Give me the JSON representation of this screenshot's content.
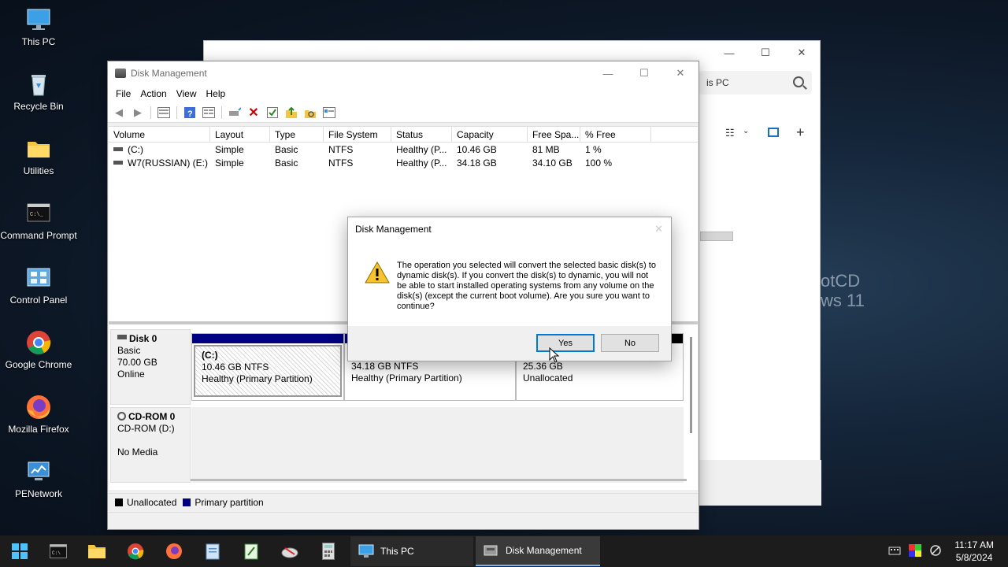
{
  "desktop": {
    "icons": [
      {
        "label": "This PC",
        "icon": "monitor-icon"
      },
      {
        "label": "Recycle Bin",
        "icon": "recycle-bin-icon"
      },
      {
        "label": "Utilities",
        "icon": "folder-icon"
      },
      {
        "label": "Command Prompt",
        "icon": "terminal-icon"
      },
      {
        "label": "Control Panel",
        "icon": "control-panel-icon"
      },
      {
        "label": "Google Chrome",
        "icon": "chrome-icon"
      },
      {
        "label": "Mozilla Firefox",
        "icon": "firefox-icon"
      },
      {
        "label": "PENetwork",
        "icon": "network-icon"
      }
    ],
    "watermark_line1": "otCD",
    "watermark_line2": "ws 11"
  },
  "explorer": {
    "search_placeholder": "is PC"
  },
  "disk_mgmt": {
    "title": "Disk Management",
    "menu": [
      "File",
      "Action",
      "View",
      "Help"
    ],
    "columns": [
      "Volume",
      "Layout",
      "Type",
      "File System",
      "Status",
      "Capacity",
      "Free Spa...",
      "% Free"
    ],
    "volumes": [
      {
        "volume": "(C:)",
        "layout": "Simple",
        "type": "Basic",
        "fs": "NTFS",
        "status": "Healthy (P...",
        "capacity": "10.46 GB",
        "free": "81 MB",
        "pct": "1 %"
      },
      {
        "volume": "W7(RUSSIAN) (E:)",
        "layout": "Simple",
        "type": "Basic",
        "fs": "NTFS",
        "status": "Healthy (P...",
        "capacity": "34.18 GB",
        "free": "34.10 GB",
        "pct": "100 %"
      }
    ],
    "disk0": {
      "name": "Disk 0",
      "type": "Basic",
      "size": "70.00 GB",
      "state": "Online",
      "partitions": [
        {
          "name": "(C:)",
          "line1": "10.46 GB NTFS",
          "line2": "Healthy (Primary Partition)"
        },
        {
          "name": "",
          "line1": "34.18 GB NTFS",
          "line2": "Healthy (Primary Partition)"
        },
        {
          "name": "",
          "line1": "25.36 GB",
          "line2": "Unallocated"
        }
      ]
    },
    "cdrom0": {
      "name": "CD-ROM 0",
      "drive": "CD-ROM (D:)",
      "media": "No Media"
    },
    "legend": {
      "unallocated": "Unallocated",
      "primary": "Primary partition",
      "unallocated_color": "#000000",
      "primary_color": "#000080"
    }
  },
  "dialog": {
    "title": "Disk Management",
    "message": "The operation you selected will convert the selected basic disk(s) to dynamic disk(s). If you convert the disk(s) to dynamic, you will not be able to start installed operating systems from any volume on the disk(s) (except the current boot volume). Are you sure you want to continue?",
    "yes": "Yes",
    "no": "No"
  },
  "taskbar": {
    "tasks": [
      {
        "label": "This PC",
        "icon": "monitor-icon"
      },
      {
        "label": "Disk Management",
        "icon": "disk-management-icon"
      }
    ],
    "time": "11:17 AM",
    "date": "5/8/2024"
  }
}
